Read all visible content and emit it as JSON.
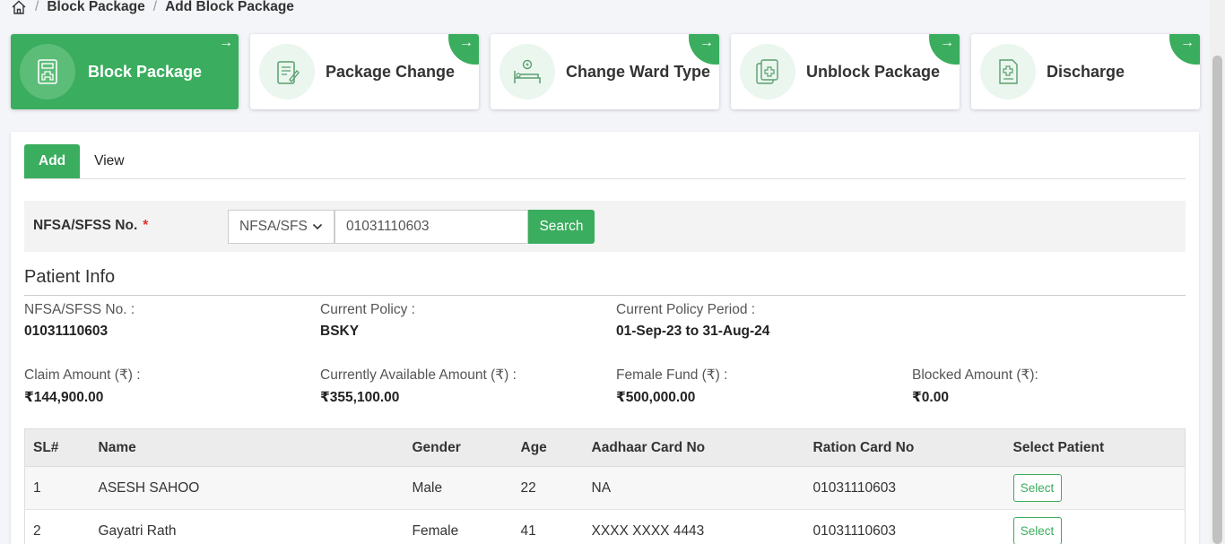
{
  "breadcrumb": {
    "home_icon": "home-icon",
    "items": [
      "Block Package",
      "Add Block Package"
    ]
  },
  "cards": [
    {
      "label": "Block Package",
      "icon": "block-package-icon",
      "arrow": "→",
      "active": true
    },
    {
      "label": "Package Change",
      "icon": "package-change-icon",
      "arrow": "→",
      "active": false
    },
    {
      "label": "Change Ward Type",
      "icon": "ward-bed-icon",
      "arrow": "→",
      "active": false
    },
    {
      "label": "Unblock Package",
      "icon": "unblock-package-icon",
      "arrow": "→",
      "active": false
    },
    {
      "label": "Discharge",
      "icon": "discharge-icon",
      "arrow": "→",
      "active": false
    }
  ],
  "tabs": [
    {
      "label": "Add",
      "active": true
    },
    {
      "label": "View",
      "active": false
    }
  ],
  "search": {
    "label": "NFSA/SFSS No.",
    "required_mark": "*",
    "select_value": "NFSA/SFS",
    "input_value": "01031110603",
    "button_label": "Search"
  },
  "patient_info": {
    "title": "Patient Info",
    "fields": {
      "nfsa_label": "NFSA/SFSS No. :",
      "nfsa_value": "01031110603",
      "policy_label": "Current Policy :",
      "policy_value": "BSKY",
      "period_label": "Current Policy Period :",
      "period_value": "01-Sep-23 to 31-Aug-24",
      "claim_label": "Claim Amount (₹) :",
      "claim_value": "₹144,900.00",
      "available_label": "Currently Available Amount (₹) :",
      "available_value": "₹355,100.00",
      "female_label": "Female Fund (₹) :",
      "female_value": "₹500,000.00",
      "blocked_label": "Blocked Amount (₹):",
      "blocked_value": "₹0.00"
    }
  },
  "table": {
    "headers": [
      "SL#",
      "Name",
      "Gender",
      "Age",
      "Aadhaar Card No",
      "Ration Card No",
      "Select Patient"
    ],
    "rows": [
      {
        "sl": "1",
        "name": "ASESH SAHOO",
        "gender": "Male",
        "age": "22",
        "aadhaar": "NA",
        "ration": "01031110603",
        "action": "Select"
      },
      {
        "sl": "2",
        "name": "Gayatri Rath",
        "gender": "Female",
        "age": "41",
        "aadhaar": "XXXX XXXX 4443",
        "ration": "01031110603",
        "action": "Select"
      }
    ]
  },
  "colors": {
    "accent": "#3aad5e",
    "page_bg": "#f4f5f9"
  }
}
